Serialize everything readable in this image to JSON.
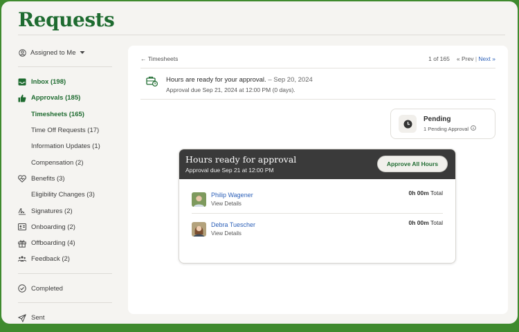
{
  "page": {
    "title": "Requests"
  },
  "sidebar": {
    "assigned_label": "Assigned to Me",
    "items": [
      {
        "label": "Inbox (198)",
        "icon": "inbox-icon"
      },
      {
        "label": "Approvals (185)",
        "icon": "thumbs-up-icon"
      },
      {
        "label": "Timesheets (165)"
      },
      {
        "label": "Time Off Requests (17)"
      },
      {
        "label": "Information Updates (1)"
      },
      {
        "label": "Compensation (2)"
      },
      {
        "label": "Benefits (3)",
        "icon": "heart-pulse-icon"
      },
      {
        "label": "Eligibility Changes (3)"
      },
      {
        "label": "Signatures (2)",
        "icon": "signature-icon"
      },
      {
        "label": "Onboarding (2)",
        "icon": "id-card-icon"
      },
      {
        "label": "Offboarding (4)",
        "icon": "gift-icon"
      },
      {
        "label": "Feedback (2)",
        "icon": "people-icon"
      }
    ],
    "completed_label": "Completed",
    "sent_label": "Sent"
  },
  "main": {
    "back_label": "← Timesheets",
    "pager": {
      "position": "1 of 165",
      "prev": "« Prev",
      "separator": "|",
      "next": "Next »"
    },
    "notice": {
      "headline": "Hours are ready for your approval.",
      "date": " – Sep 20, 2024",
      "due": "Approval due Sep 21, 2024 at 12:00 PM (0 days)."
    },
    "status": {
      "label": "Pending",
      "detail": "1 Pending Approval"
    },
    "card": {
      "title": "Hours ready for approval",
      "subtitle": "Approval due Sep 21 at 12:00 PM",
      "approve_label": "Approve All Hours",
      "employees": [
        {
          "name": "Philip Wagener",
          "details": "View Details",
          "hours": "0h 00m",
          "total_label": "Total"
        },
        {
          "name": "Debra Tuescher",
          "details": "View Details",
          "hours": "0h 00m",
          "total_label": "Total"
        }
      ]
    }
  },
  "colors": {
    "brand_green": "#1e6b30",
    "frame_green": "#3f8a2e",
    "link_blue": "#2b5fb8",
    "card_header": "#3a3a3a"
  }
}
